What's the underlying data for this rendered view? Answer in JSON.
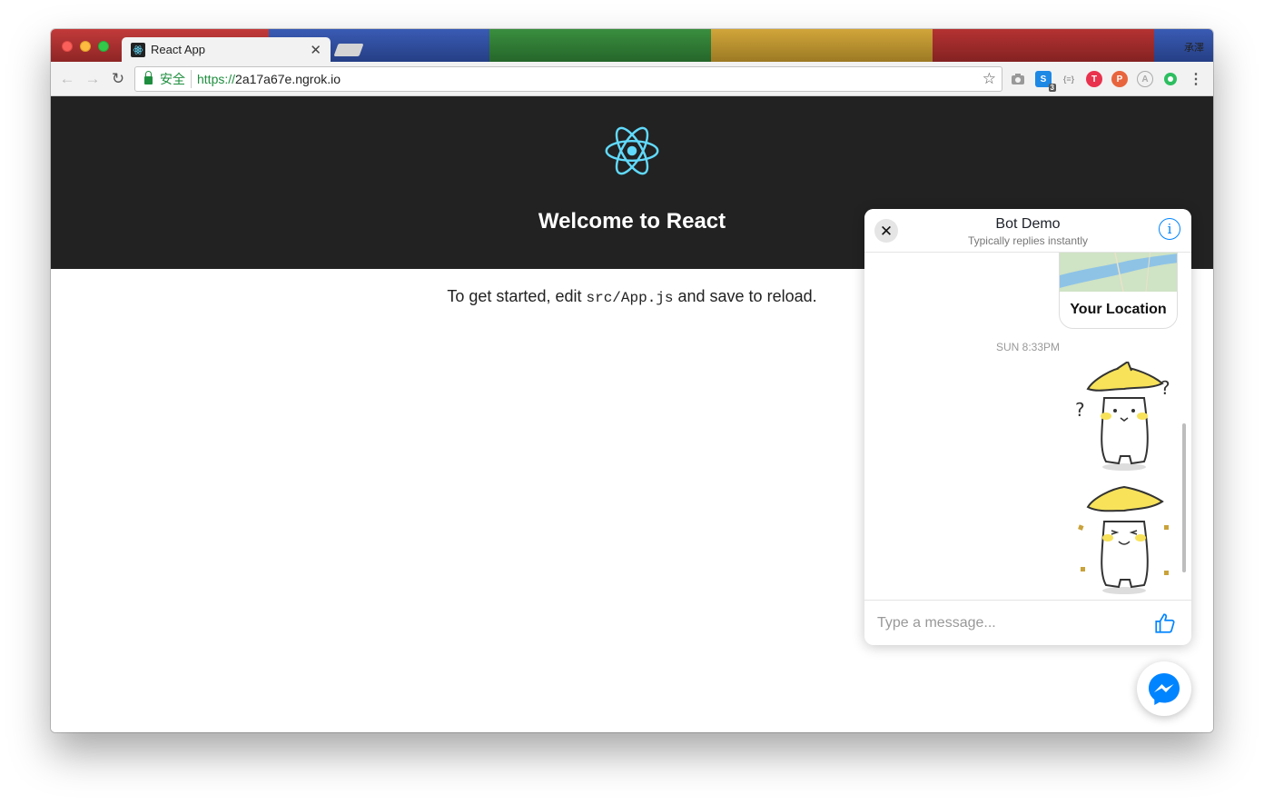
{
  "browser": {
    "tab_title": "React App",
    "tab_close": "✕",
    "profile_name": "承澤",
    "secure_label": "安全",
    "url_scheme": "https://",
    "url_host": "2a17a67e.ngrok.io",
    "bookmark_icon": "star-icon",
    "extension_badge": "3",
    "tab_colors": [
      "#a33232",
      "#2c4a9a",
      "#2d7a33",
      "#c49a2a",
      "#a8272a"
    ]
  },
  "app": {
    "title": "Welcome to React",
    "intro_before": "To get started, edit ",
    "intro_code": "src/App.js",
    "intro_after": " and save to reload.",
    "header_color": "#222222",
    "logo_color": "#61dafb"
  },
  "chat": {
    "name": "Bot Demo",
    "status": "Typically replies instantly",
    "location_label": "Your Location",
    "timestamp": "SUN 8:33PM",
    "composer_placeholder": "Type a message...",
    "accent": "#0084ff"
  }
}
